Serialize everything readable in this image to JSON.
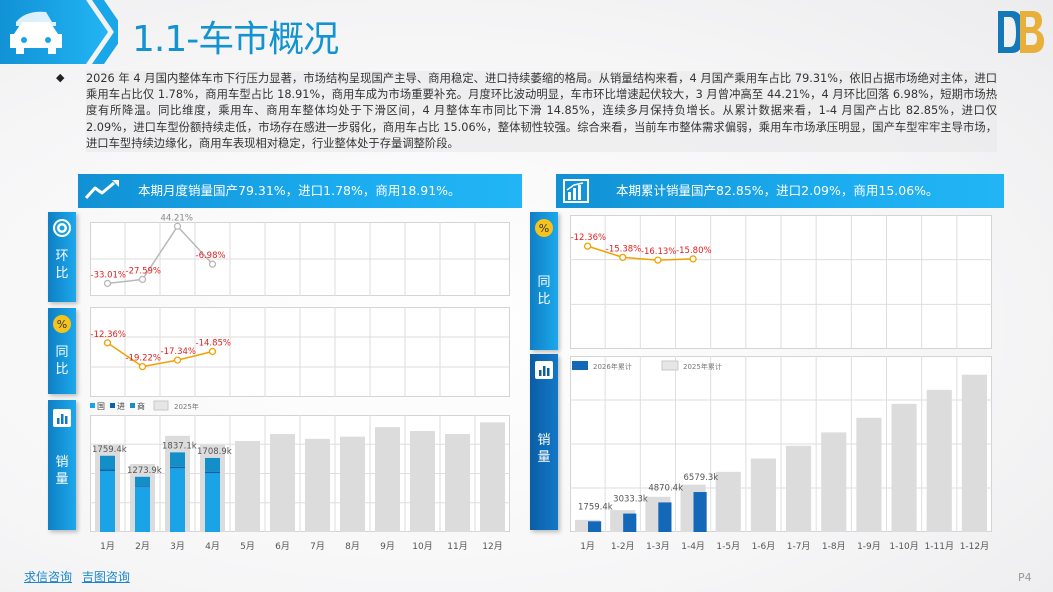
{
  "header": {
    "title": "1.1-车市概况"
  },
  "summary": {
    "bullet": "◆",
    "text": "2026 年 4 月国内整体车市下行压力显著，市场结构呈现国产主导、商用稳定、进口持续萎缩的格局。从销量结构来看，4 月国产乘用车占比 79.31%，依旧占据市场绝对主体，进口乘用车占比仅 1.78%，商用车型占比 18.91%，商用车成为市场重要补充。月度环比波动明显，车市环比增速起伏较大，3 月曾冲高至 44.21%，4 月环比回落 6.98%，短期市场热度有所降温。同比维度，乘用车、商用车整体均处于下滑区间，4 月整体车市同比下滑 14.85%，连续多月保持负增长。从累计数据来看，1-4 月国产占比 82.85%，进口仅 2.09%，进口车型份额持续走低，市场存在感进一步弱化，商用车占比 15.06%，整体韧性较强。综合来看，当前车市整体需求偏弱，乘用车市场承压明显，国产车型牢牢主导市场，进口车型持续边缘化，商用车表现相对稳定，行业整体处于存量调整阶段。"
  },
  "left": {
    "banner": "本期月度销量国产79.31%，进口1.78%，商用18.91%。",
    "tabs": {
      "mom": "环\n比",
      "yoy": "同\n比",
      "sales": "销\n量"
    }
  },
  "right": {
    "banner": "本期累计销量国产82.85%，进口2.09%，商用15.06%。",
    "tabs": {
      "yoy": "同\n比",
      "sales": "销\n量"
    }
  },
  "footer": {
    "links": [
      "求信咨询",
      "吉图咨询"
    ],
    "page": "P4"
  },
  "colors": {
    "accent": "#1394d0",
    "domestic": "#1aa3e6",
    "import": "#0d63ab",
    "commercial": "#128ec9",
    "prior_year": "#dcdcdc",
    "line_gray": "#b8b8b8",
    "line_orange": "#f2a100",
    "label_red": "#e02020"
  },
  "chart_data": [
    {
      "id": "monthly-mom",
      "type": "line",
      "x": [
        "1月",
        "2月",
        "3月",
        "4月",
        "5月",
        "6月",
        "7月",
        "8月",
        "9月",
        "10月",
        "11月",
        "12月"
      ],
      "series": [
        {
          "values": [
            -33.01,
            -27.59,
            44.21,
            -6.98
          ],
          "labels": [
            "-33.01%",
            "-27.59%",
            "44.21%",
            "-6.98%"
          ],
          "label_colors": [
            "red",
            "red",
            "gray",
            "red"
          ]
        }
      ]
    },
    {
      "id": "monthly-yoy",
      "type": "line",
      "x": [
        "1月",
        "2月",
        "3月",
        "4月",
        "5月",
        "6月",
        "7月",
        "8月",
        "9月",
        "10月",
        "11月",
        "12月"
      ],
      "series": [
        {
          "values": [
            -12.36,
            -19.22,
            -17.34,
            -14.85
          ],
          "labels": [
            "-12.36%",
            "-19.22%",
            "-17.34%",
            "-14.85%"
          ]
        }
      ]
    },
    {
      "id": "monthly-sales",
      "type": "bar",
      "categories": [
        "1月",
        "2月",
        "3月",
        "4月",
        "5月",
        "6月",
        "7月",
        "8月",
        "9月",
        "10月",
        "11月",
        "12月"
      ],
      "legend": [
        "国",
        "进",
        "商",
        "2025年"
      ],
      "current_total": [
        1759.4,
        1273.9,
        1837.1,
        1708.9
      ],
      "current_labels": [
        "1759.4k",
        "1273.9k",
        "1837.1k",
        "1708.9k"
      ],
      "domestic_share": [
        0.8,
        0.82,
        0.8,
        0.7931
      ],
      "import_share": [
        0.02,
        0.02,
        0.02,
        0.0178
      ],
      "commercial_share": [
        0.18,
        0.16,
        0.18,
        0.1891
      ],
      "prior_year": [
        2010,
        1570,
        2220,
        2010,
        2100,
        2260,
        2150,
        2200,
        2420,
        2330,
        2260,
        2530
      ]
    },
    {
      "id": "cumulative-yoy",
      "type": "line",
      "x": [
        "1月",
        "1-2月",
        "1-3月",
        "1-4月",
        "1-5月",
        "1-6月",
        "1-7月",
        "1-8月",
        "1-9月",
        "1-10月",
        "1-11月",
        "1-12月"
      ],
      "series": [
        {
          "values": [
            -12.36,
            -15.38,
            -16.13,
            -15.8
          ],
          "labels": [
            "-12.36%",
            "-15.38%",
            "-16.13%",
            "-15.80%"
          ]
        }
      ]
    },
    {
      "id": "cumulative-sales",
      "type": "bar",
      "categories": [
        "1月",
        "1-2月",
        "1-3月",
        "1-4月",
        "1-5月",
        "1-6月",
        "1-7月",
        "1-8月",
        "1-9月",
        "1-10月",
        "1-11月",
        "1-12月"
      ],
      "legend": [
        "2026年累计",
        "2025年累计"
      ],
      "current": [
        1759.4,
        3033.3,
        4870.4,
        6579.3
      ],
      "current_labels": [
        "1759.4k",
        "3033.3k",
        "4870.4k",
        "6579.3k"
      ],
      "prior_year": [
        2000,
        3600,
        5800,
        7800,
        9900,
        12100,
        14200,
        16400,
        18800,
        21100,
        23400,
        25900
      ],
      "ylim": [
        0,
        27000
      ]
    }
  ]
}
